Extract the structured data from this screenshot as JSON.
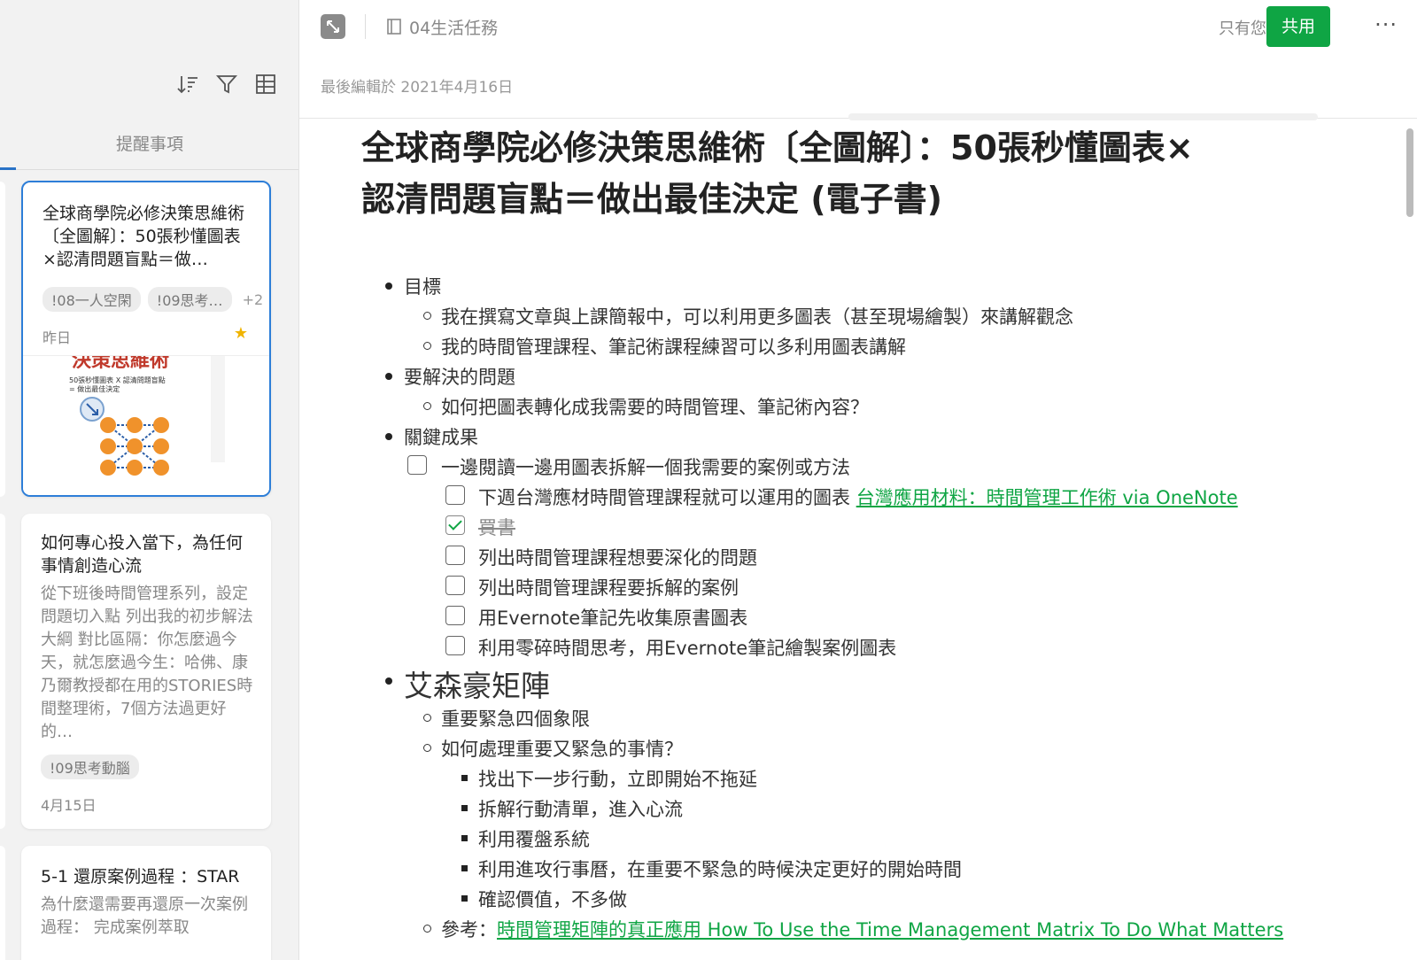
{
  "sidebar": {
    "tab_label": "提醒事項",
    "cards": [
      {
        "title": "全球商學院必修決策思維術〔全圖解〕：50張秒懂圖表×認清問題盲點＝做…",
        "tags": [
          "!08一人空閑",
          "!09思考…"
        ],
        "tags_more": "+2",
        "date": "昨日",
        "thumb_caption_1": "決策思維術",
        "thumb_caption_2": "50張秒懂圖表 X 認清問題盲點",
        "thumb_caption_3": "= 做出最佳決定"
      },
      {
        "title": "如何專心投入當下，為任何事情創造心流",
        "snippet": "從下班後時間管理系列，設定問題切入點 列出我的初步解法大綱 對比區隔：你怎麼過今天，就怎麼過今生：哈佛、康乃爾教授都在用的STORIES時間整理術，7個方法過更好的…",
        "tags": [
          "!09思考動腦"
        ],
        "date": "4月15日"
      },
      {
        "title": "5-1 還原案例過程 ：STAR",
        "snippet": "為什麼還需要再還原一次案例過程： 完成案例萃取"
      }
    ]
  },
  "header": {
    "notebook": "04生活任務",
    "visibility": "只有您",
    "share_label": "共用",
    "more": "···",
    "last_edited": "最後編輯於 2021年4月16日"
  },
  "note": {
    "title_line1": "全球商學院必修決策思維術〔全圖解〕：50張秒懂圖表×",
    "title_line2": "認清問題盲點＝做出最佳決定 (電子書)",
    "items": {
      "goal": "目標",
      "goal_1": "我在撰寫文章與上課簡報中，可以利用更多圖表（甚至現場繪製）來講解觀念",
      "goal_2": "我的時間管理課程、筆記術課程練習可以多利用圖表講解",
      "problem": "要解決的問題",
      "problem_1": "如何把圖表轉化成我需要的時間管理、筆記術內容？",
      "results": "關鍵成果",
      "task_main": "一邊閱讀一邊用圖表拆解一個我需要的案例或方法",
      "task_1": "下週台灣應材時間管理課程就可以運用的圖表 ",
      "task_1_link": "台灣應用材料：時間管理工作術 via OneNote",
      "task_2": "買書",
      "task_3": "列出時間管理課程想要深化的問題",
      "task_4": "列出時間管理課程要拆解的案例",
      "task_5": "用Evernote筆記先收集原書圖表",
      "task_6": "利用零碎時間思考，用Evernote筆記繪製案例圖表",
      "matrix": "艾森豪矩陣",
      "matrix_1": "重要緊急四個象限",
      "matrix_2": "如何處理重要又緊急的事情？",
      "sub_1": "找出下一步行動，立即開始不拖延",
      "sub_2": "拆解行動清單，進入心流",
      "sub_3": "利用覆盤系統",
      "sub_4": "利用進攻行事曆，在重要不緊急的時候決定更好的開始時間",
      "sub_5": "確認價值，不多做",
      "ref_label": "參考：",
      "ref_link": "時間管理矩陣的真正應用 How To Use the Time Management Matrix To Do What Matters"
    }
  },
  "colors": {
    "accent_green": "#0fa544",
    "selection_blue": "#2d7ed8",
    "star": "#f0b400"
  }
}
